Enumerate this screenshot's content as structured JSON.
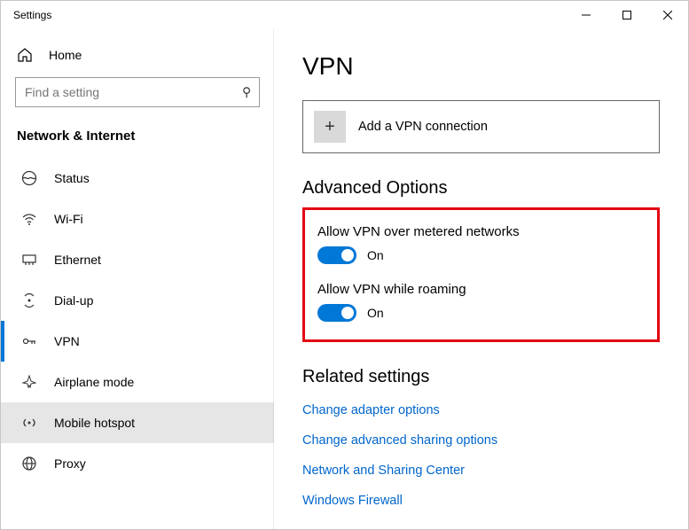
{
  "titlebar": {
    "title": "Settings"
  },
  "home": {
    "label": "Home"
  },
  "search": {
    "placeholder": "Find a setting"
  },
  "section_title": "Network & Internet",
  "sidebar": {
    "items": [
      {
        "label": "Status",
        "icon": "status-icon"
      },
      {
        "label": "Wi-Fi",
        "icon": "wifi-icon"
      },
      {
        "label": "Ethernet",
        "icon": "ethernet-icon"
      },
      {
        "label": "Dial-up",
        "icon": "dialup-icon"
      },
      {
        "label": "VPN",
        "icon": "vpn-icon"
      },
      {
        "label": "Airplane mode",
        "icon": "airplane-icon"
      },
      {
        "label": "Mobile hotspot",
        "icon": "hotspot-icon"
      },
      {
        "label": "Proxy",
        "icon": "proxy-icon"
      }
    ],
    "selected_index": 4,
    "hover_index": 6
  },
  "main": {
    "title": "VPN",
    "add_vpn_label": "Add a VPN connection",
    "advanced_header": "Advanced Options",
    "option1": {
      "label": "Allow VPN over metered networks",
      "state": "On"
    },
    "option2": {
      "label": "Allow VPN while roaming",
      "state": "On"
    },
    "related_header": "Related settings",
    "related_links": [
      "Change adapter options",
      "Change advanced sharing options",
      "Network and Sharing Center",
      "Windows Firewall"
    ]
  }
}
